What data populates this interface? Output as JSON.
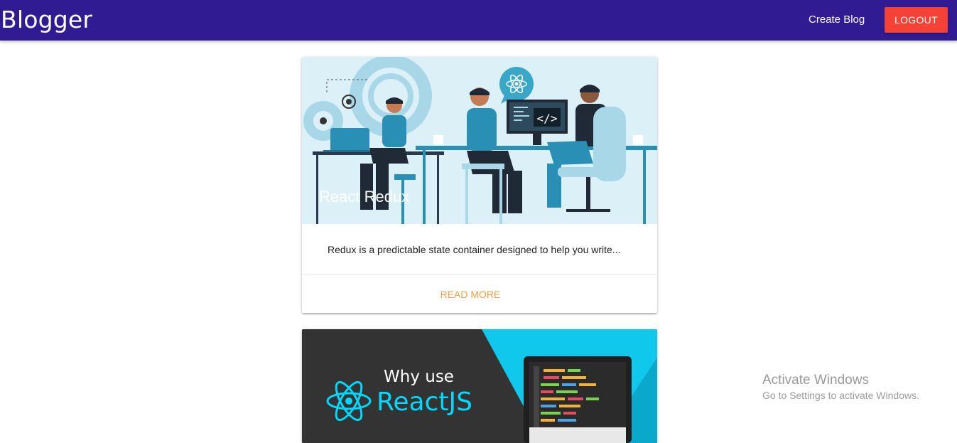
{
  "navbar": {
    "brand": "Blogger",
    "create_link": "Create Blog",
    "logout_label": "LOGOUT"
  },
  "posts": [
    {
      "title": "React Redux",
      "excerpt": "Redux is a predictable state container designed to help you write...",
      "action_label": "READ MORE"
    },
    {
      "image_heading": "Why use",
      "image_brand": "ReactJS",
      "code_symbol": "</>"
    }
  ],
  "watermark": {
    "title": "Activate Windows",
    "subtitle": "Go to Settings to activate Windows."
  },
  "colors": {
    "navbar": "#311b92",
    "logout": "#f44336",
    "read_more": "#f0a04b",
    "react_cyan": "#00d8ff"
  }
}
